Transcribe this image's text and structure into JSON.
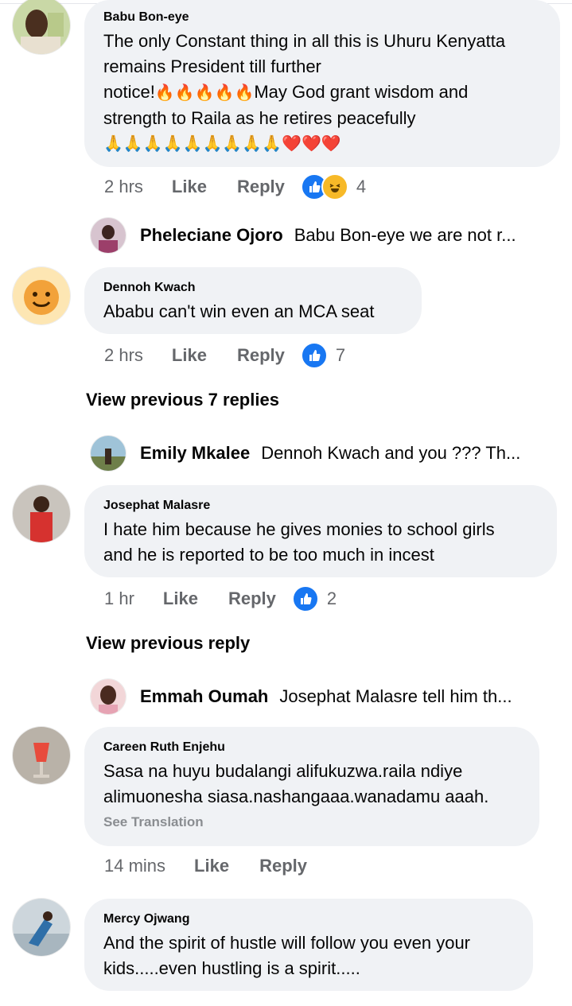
{
  "comments": [
    {
      "author": "Babu Bon-eye",
      "line1": "The only Constant thing in all this is Uhuru Kenyatta",
      "line2": "remains President till further",
      "line3a": "notice!",
      "line3_emojis": "🔥🔥🔥🔥🔥",
      "line3b": "May God grant wisdom and",
      "line4": "strength to Raila as he retires peacefully",
      "line5_emojis": "🙏🙏🙏🙏🙏🙏🙏🙏🙏❤️❤️❤️",
      "time": "2 hrs",
      "like_label": "Like",
      "reply_label": "Reply",
      "reaction_count": "4"
    },
    {
      "author": "Dennoh Kwach",
      "text": "Ababu can't  win even an MCA seat",
      "time": "2 hrs",
      "like_label": "Like",
      "reply_label": "Reply",
      "reaction_count": "7"
    },
    {
      "author": "Josephat Malasre",
      "line1": "I hate him because  he gives monies to school girls",
      "line2": "and he is reported to be too much in incest",
      "time": "1 hr",
      "like_label": "Like",
      "reply_label": "Reply",
      "reaction_count": "2"
    },
    {
      "author": "Careen Ruth Enjehu",
      "line1": "Sasa na huyu budalangi alifukuzwa.raila ndiye",
      "line2": "alimuonesha siasa.nashangaaa.wanadamu aaah.",
      "see_translation": "See Translation",
      "time": "14 mins",
      "like_label": "Like",
      "reply_label": "Reply"
    },
    {
      "author": "Mercy Ojwang",
      "line1": "And the spirit of hustle will follow you even your",
      "line2": "kids.....even hustling is a spirit....."
    }
  ],
  "replies": [
    {
      "author": "Pheleciane Ojoro",
      "preview": "Babu Bon-eye we are not r..."
    },
    {
      "author": "Emily Mkalee",
      "preview": "Dennoh Kwach and you ??? Th..."
    },
    {
      "author": "Emmah Oumah",
      "preview": "Josephat Malasre tell him th..."
    }
  ],
  "view_previous": [
    "View previous 7 replies",
    "View previous reply"
  ],
  "colors": {
    "like_blue": "#1877f2",
    "bubble_gray": "#f0f2f5",
    "meta_gray": "#65676b"
  }
}
